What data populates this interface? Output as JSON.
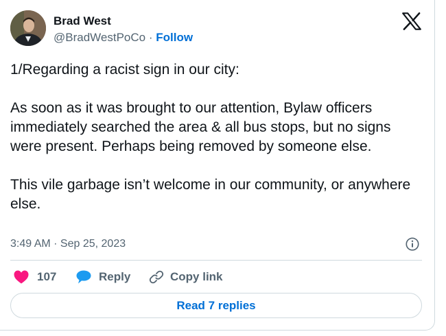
{
  "author": {
    "name": "Brad West",
    "handle": "@BradWestPoCo",
    "separator": "·",
    "follow_label": "Follow"
  },
  "tweet": {
    "paragraphs": [
      "1/Regarding a racist sign in our city:",
      "As soon as it was brought to our attention, Bylaw officers immediately searched the area & all bus stops, but no signs were present. Perhaps being removed by someone else.",
      "This vile garbage isn’t welcome in our community, or anywhere else."
    ],
    "timestamp": "3:49 AM · Sep 25, 2023"
  },
  "actions": {
    "like_count": "107",
    "reply_label": "Reply",
    "copy_link_label": "Copy link"
  },
  "read_replies_label": "Read 7 replies",
  "icons": {
    "brand": "x-logo-icon",
    "info": "info-icon",
    "like": "heart-icon",
    "reply": "speech-bubble-icon",
    "copy": "link-icon"
  },
  "colors": {
    "heart": "#f91880",
    "reply": "#1d9bf0",
    "link_blue": "#006fd6",
    "muted_text": "#536471",
    "border": "#cfd9de"
  }
}
